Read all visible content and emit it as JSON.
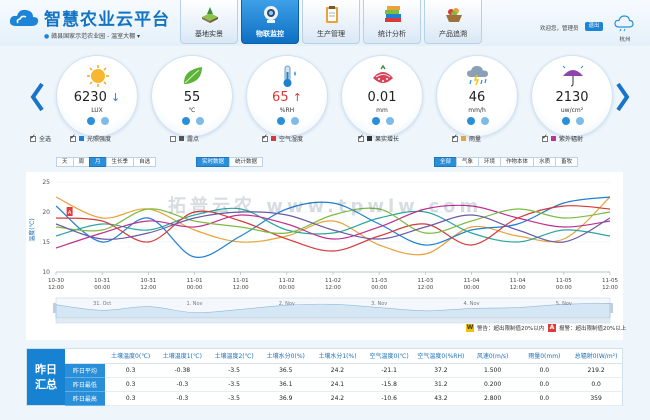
{
  "app": {
    "title": "智慧农业云平台",
    "location": "赣县国家示范农业园 - 温室大棚",
    "welcome": "欢迎您，管理员",
    "exit_label": "退出",
    "weather_city": "杭州"
  },
  "nav": {
    "tabs": [
      {
        "label": "基地实景",
        "icon": "base-scene-icon"
      },
      {
        "label": "物联监控",
        "icon": "camera-icon",
        "active": true
      },
      {
        "label": "生产管理",
        "icon": "clipboard-icon"
      },
      {
        "label": "统计分析",
        "icon": "books-icon"
      },
      {
        "label": "产品追溯",
        "icon": "basket-icon"
      }
    ]
  },
  "sensors": [
    {
      "value": "6230",
      "trend": "↓",
      "unit": "LUX",
      "icon": "sun-icon",
      "label": "光照强度",
      "checked": true,
      "color": "#1f7fd0"
    },
    {
      "value": "55",
      "trend": "",
      "unit": "℃",
      "icon": "leaf-icon",
      "label": "露点",
      "checked": false,
      "color": "#555555"
    },
    {
      "value": "65",
      "trend": "↑",
      "unit": "%RH",
      "icon": "thermometer-icon",
      "label": "空气湿度",
      "checked": true,
      "color": "#d63a3a"
    },
    {
      "value": "0.01",
      "trend": "",
      "unit": "mm",
      "icon": "fruit-icon",
      "label": "果实增长",
      "checked": true,
      "color": "#333333"
    },
    {
      "value": "46",
      "trend": "",
      "unit": "mm/h",
      "icon": "rain-cloud-icon",
      "label": "雨量",
      "checked": true,
      "color": "#e8a33c"
    },
    {
      "value": "2130",
      "trend": "",
      "unit": "uw/cm²",
      "icon": "umbrella-icon",
      "label": "紫外辐射",
      "checked": true,
      "color": "#c0308f"
    }
  ],
  "select_all": {
    "label": "全选",
    "checked": true
  },
  "toolbar": {
    "periods": [
      {
        "label": "天"
      },
      {
        "label": "周"
      },
      {
        "label": "月",
        "active": true
      },
      {
        "label": "生长季"
      },
      {
        "label": "自选"
      }
    ],
    "modes": [
      {
        "label": "实时数据",
        "active": true
      },
      {
        "label": "统计数据"
      }
    ],
    "filters": [
      {
        "label": "全部",
        "active": true
      },
      {
        "label": "气象"
      },
      {
        "label": "环境"
      },
      {
        "label": "作物本体"
      },
      {
        "label": "水质"
      },
      {
        "label": "畜牧"
      }
    ]
  },
  "alarms": [
    {
      "mark": "W",
      "label": "警告：超出限制值20%以内",
      "color": "#f2c200"
    },
    {
      "mark": "A",
      "label": "报警：超出限制值20%以上",
      "color": "#e23b3b"
    }
  ],
  "chart_data": {
    "type": "line",
    "ylabel": "温度(℃)",
    "ylim": [
      10,
      25
    ],
    "yticks": [
      10,
      15,
      20,
      25
    ],
    "xlim": [
      0,
      12
    ],
    "x_ticks": [
      {
        "x": 0,
        "line1": "10-30",
        "line2": "12:00"
      },
      {
        "x": 1,
        "line1": "10-31",
        "line2": "00:00"
      },
      {
        "x": 2,
        "line1": "10-31",
        "line2": "12:00"
      },
      {
        "x": 3,
        "line1": "11-01",
        "line2": "00:00"
      },
      {
        "x": 4,
        "line1": "11-01",
        "line2": "12:00"
      },
      {
        "x": 5,
        "line1": "11-02",
        "line2": "00:00"
      },
      {
        "x": 6,
        "line1": "11-02",
        "line2": "12:00"
      },
      {
        "x": 7,
        "line1": "11-03",
        "line2": "00:00"
      },
      {
        "x": 8,
        "line1": "11-03",
        "line2": "12:00"
      },
      {
        "x": 9,
        "line1": "11-04",
        "line2": "00:00"
      },
      {
        "x": 10,
        "line1": "11-04",
        "line2": "12:00"
      },
      {
        "x": 11,
        "line1": "11-05",
        "line2": "00:00"
      },
      {
        "x": 12,
        "line1": "11-05",
        "line2": "12:00"
      }
    ],
    "x": [
      0,
      1,
      2,
      3,
      4,
      5,
      6,
      7,
      8,
      9,
      10,
      11,
      12
    ],
    "series": [
      {
        "color": "#e8a33c",
        "values": [
          22.5,
          19.0,
          20.5,
          17.0,
          15.0,
          16.0,
          18.5,
          14.5,
          13.0,
          17.5,
          16.0,
          15.5,
          22.5
        ]
      },
      {
        "color": "#1f7fd0",
        "values": [
          21.0,
          15.0,
          19.0,
          12.5,
          16.0,
          20.5,
          21.5,
          18.0,
          14.5,
          17.0,
          18.0,
          21.5,
          22.5
        ]
      },
      {
        "color": "#2aa6a0",
        "values": [
          16.0,
          18.0,
          17.0,
          19.5,
          20.5,
          17.0,
          16.5,
          19.0,
          20.0,
          16.5,
          15.0,
          17.0,
          16.0
        ]
      },
      {
        "color": "#c0308f",
        "values": [
          14.0,
          16.5,
          18.5,
          17.5,
          19.5,
          18.0,
          15.5,
          17.5,
          20.5,
          21.0,
          19.0,
          17.5,
          18.5
        ]
      },
      {
        "color": "#d63a3a",
        "values": [
          19.0,
          18.5,
          15.0,
          20.0,
          18.5,
          15.5,
          13.5,
          16.0,
          18.0,
          14.5,
          19.0,
          21.0,
          20.5
        ]
      },
      {
        "color": "#7dbb42",
        "values": [
          17.5,
          17.0,
          20.5,
          18.5,
          17.5,
          16.5,
          19.5,
          20.5,
          16.5,
          18.5,
          20.5,
          19.0,
          20.0
        ]
      },
      {
        "color": "#6b5aa6",
        "values": [
          18.0,
          15.5,
          16.5,
          19.0,
          20.0,
          19.5,
          17.0,
          15.5,
          17.5,
          19.5,
          17.0,
          15.0,
          19.0
        ]
      }
    ],
    "navigator_labels": [
      "31. Oct",
      "1. Nov",
      "2. Nov",
      "3. Nov",
      "4. Nov",
      "5. Nov"
    ],
    "alarm_marker": {
      "x": 0.1,
      "y": 20.0,
      "label": "A"
    }
  },
  "summary": {
    "title_line1": "昨日",
    "title_line2": "汇总",
    "columns": [
      "土壤温度0(℃)",
      "土壤温度1(℃)",
      "土壤温度2(℃)",
      "土壤水分0(%)",
      "土壤水分1(%)",
      "空气温度0(℃)",
      "空气温度0(%RH)",
      "风速0(m/s)",
      "雨量0(mm)",
      "总辐射0(W/m²)"
    ],
    "rows": [
      {
        "label": "昨日平均",
        "values": [
          "0.3",
          "-0.38",
          "-3.5",
          "36.5",
          "24.2",
          "-21.1",
          "37.2",
          "1.500",
          "0.0",
          "219.2"
        ]
      },
      {
        "label": "昨日最低",
        "values": [
          "0.3",
          "-0.3",
          "-3.5",
          "36.1",
          "24.1",
          "-15.8",
          "31.2",
          "0.200",
          "0.0",
          "0.0"
        ]
      },
      {
        "label": "昨日最高",
        "values": [
          "0.3",
          "-0.3",
          "-3.5",
          "36.9",
          "24.2",
          "-10.6",
          "43.2",
          "2.800",
          "0.0",
          "359"
        ]
      }
    ]
  }
}
